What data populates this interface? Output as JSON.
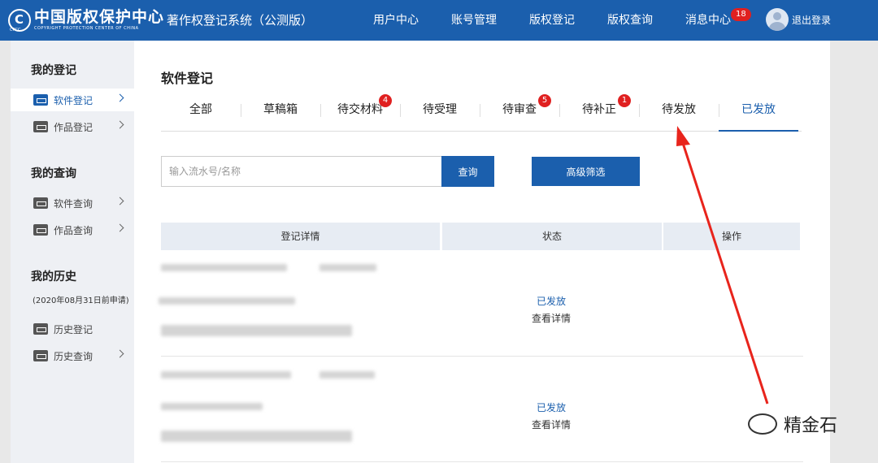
{
  "header": {
    "logo_text": "中国版权保护中心",
    "logo_en": "COPYRIGHT PROTECTION CENTER OF CHINA",
    "logo_small": "CPCC",
    "system_title": "著作权登记系统（公测版）",
    "nav": [
      "用户中心",
      "账号管理",
      "版权登记",
      "版权查询",
      "消息中心"
    ],
    "message_count": "18",
    "logout": "退出登录"
  },
  "sidebar": {
    "sections": [
      {
        "title": "我的登记",
        "items": [
          {
            "label": "软件登记",
            "icon": "software-icon",
            "active": true
          },
          {
            "label": "作品登记",
            "icon": "works-icon"
          }
        ]
      },
      {
        "title": "我的查询",
        "items": [
          {
            "label": "软件查询",
            "icon": "software-icon"
          },
          {
            "label": "作品查询",
            "icon": "works-icon"
          }
        ]
      },
      {
        "title": "我的历史",
        "note": "(2020年08月31日前申请)",
        "items": [
          {
            "label": "历史登记",
            "icon": "history-icon"
          },
          {
            "label": "历史查询",
            "icon": "history-icon"
          }
        ]
      }
    ]
  },
  "main": {
    "title": "软件登记",
    "tabs": [
      {
        "label": "全部"
      },
      {
        "label": "草稿箱"
      },
      {
        "label": "待交材料",
        "badge": "4"
      },
      {
        "label": "待受理"
      },
      {
        "label": "待审查",
        "badge": "5"
      },
      {
        "label": "待补正",
        "badge": "1"
      },
      {
        "label": "待发放"
      },
      {
        "label": "已发放",
        "active": true
      }
    ],
    "search_placeholder": "输入流水号/名称",
    "search_button": "查询",
    "advanced_button": "高级筛选",
    "table_headers": [
      "登记详情",
      "状态",
      "操作"
    ],
    "rows": [
      {
        "status": "已发放",
        "action": "查看详情"
      },
      {
        "status": "已发放",
        "action": "查看详情"
      }
    ]
  },
  "watermark": "精金石",
  "colors": {
    "brand": "#1b5fad",
    "badge": "#e02020",
    "arrow": "#e8241c"
  }
}
